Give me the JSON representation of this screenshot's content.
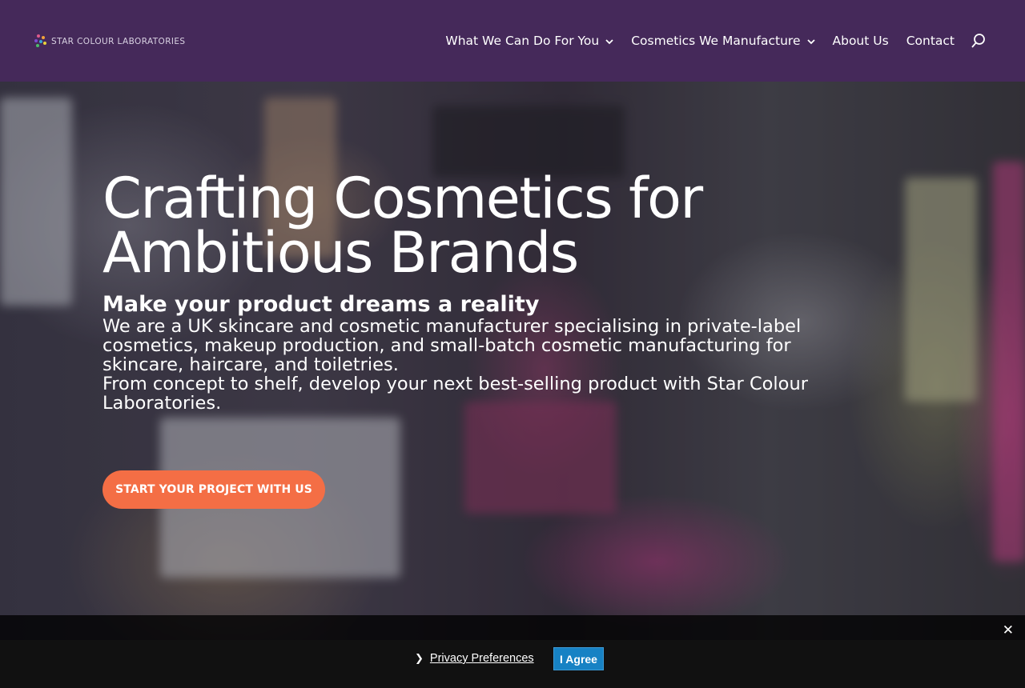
{
  "header": {
    "logo_text": "Star Colour Laboratories",
    "nav": [
      {
        "label": "What We Can Do For You",
        "has_dropdown": true
      },
      {
        "label": "Cosmetics We Manufacture",
        "has_dropdown": true
      },
      {
        "label": "About Us",
        "has_dropdown": false
      },
      {
        "label": "Contact",
        "has_dropdown": false
      }
    ],
    "search_icon": "search-icon",
    "dropdown_icon": "chevron-down-icon"
  },
  "hero": {
    "title_line1": "Crafting Cosmetics for",
    "title_line2": "Ambitious Brands",
    "subtitle": "Make your product dreams a reality",
    "body_line1": "We are a UK skincare and cosmetic manufacturer specialising in private-label",
    "body_line2": "cosmetics, makeup production, and small-batch cosmetic manufacturing for",
    "body_line3": "skincare, haircare, and toiletries.",
    "body_line4": "From concept to shelf, develop your next best-selling product with Star Colour",
    "body_line5": "Laboratories.",
    "cta_label": "Start your project with us"
  },
  "cookie_bar": {
    "close_symbol": "✕",
    "preferences_arrow": "❯",
    "preferences_label": "Privacy Preferences",
    "agree_label": "I Agree"
  },
  "colors": {
    "header_bg": "#45295a",
    "cta_bg": "#f46e45",
    "agree_bg": "#1782c4",
    "cookie_bg": "#111111"
  }
}
